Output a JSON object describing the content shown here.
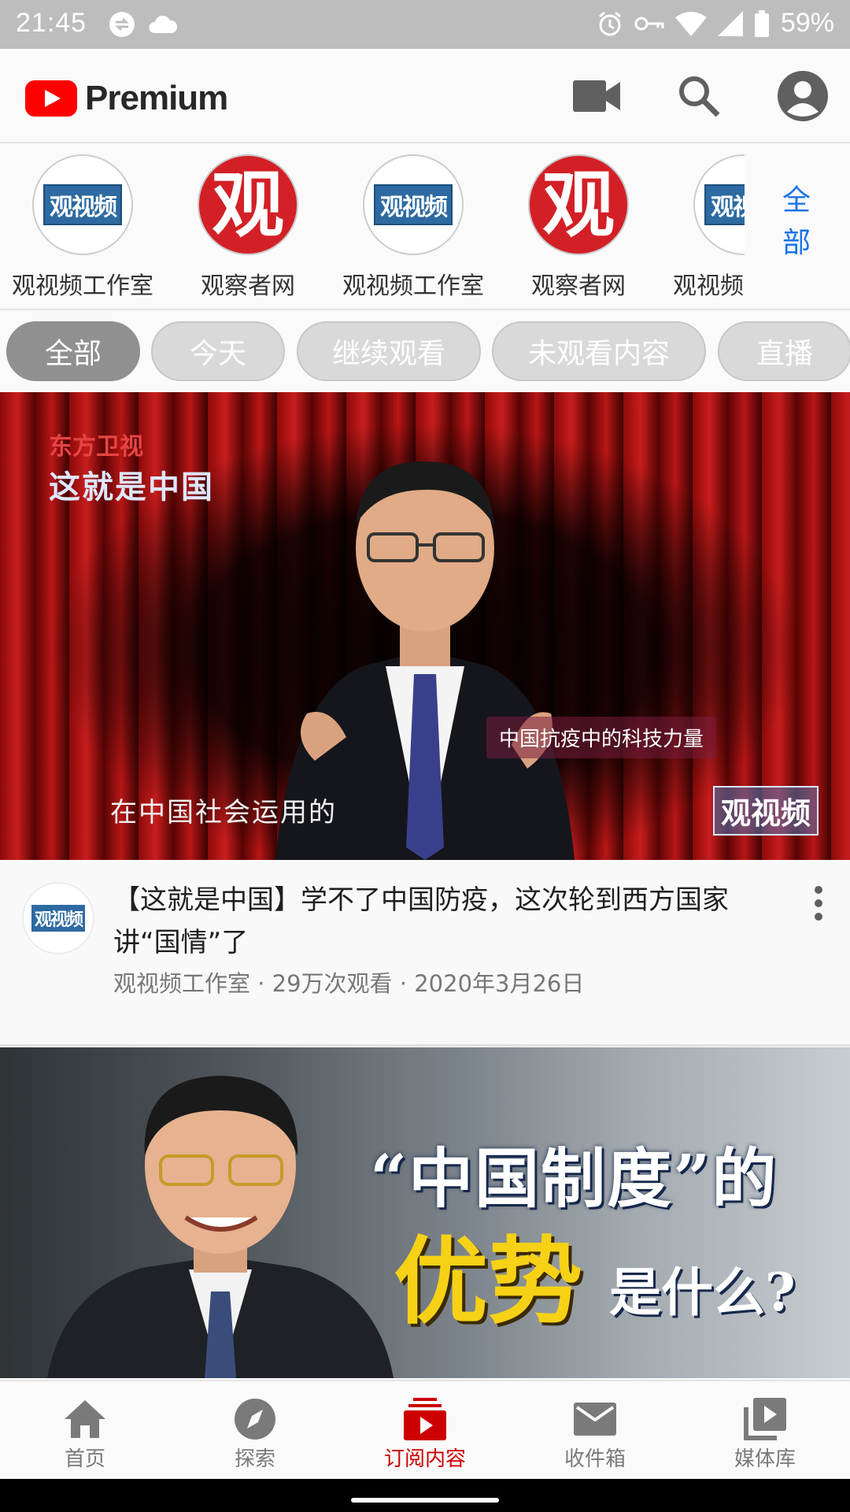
{
  "status_bar": {
    "time": "21:45",
    "battery": "59%"
  },
  "app_bar": {
    "logo_text": "Premium",
    "brand_color": "#ff0000"
  },
  "channels": {
    "items": [
      {
        "name": "观视频工作室",
        "avatar_text": "观视频",
        "style": "blue"
      },
      {
        "name": "观察者网",
        "avatar_text": "观",
        "style": "red"
      },
      {
        "name": "观视频工作室",
        "avatar_text": "观视频",
        "style": "blue"
      },
      {
        "name": "观察者网",
        "avatar_text": "观",
        "style": "red"
      },
      {
        "name": "观视频工作室",
        "avatar_text": "观视频",
        "style": "blue"
      }
    ],
    "all_label_line1": "全",
    "all_label_line2": "部"
  },
  "chips": [
    {
      "label": "全部",
      "active": true
    },
    {
      "label": "今天",
      "active": false
    },
    {
      "label": "继续观看",
      "active": false
    },
    {
      "label": "未观看内容",
      "active": false
    },
    {
      "label": "直播",
      "active": false
    }
  ],
  "videos": [
    {
      "thumbnail": {
        "logo_line1": "东方卫视",
        "logo_line2": "这就是中国",
        "lower_third": "中国抗疫中的科技力量",
        "subtitle": "在中国社会运用的",
        "watermark": "观视频"
      },
      "channel_avatar_text": "观视频",
      "title": "【这就是中国】学不了中国防疫，这次轮到西方国家讲“国情”了",
      "meta": "观视频工作室 · 29万次观看 · 2020年3月26日"
    },
    {
      "thumbnail": {
        "quote_text": "“中国制度”的",
        "highlight_text": "优势",
        "question_text": "是什么?"
      }
    }
  ],
  "bottom_nav": [
    {
      "label": "首页",
      "icon": "home-icon",
      "active": false
    },
    {
      "label": "探索",
      "icon": "compass-icon",
      "active": false
    },
    {
      "label": "订阅内容",
      "icon": "subscriptions-icon",
      "active": true
    },
    {
      "label": "收件箱",
      "icon": "mail-icon",
      "active": false
    },
    {
      "label": "媒体库",
      "icon": "library-icon",
      "active": false
    }
  ],
  "colors": {
    "active_nav": "#cc0000",
    "link_blue": "#1a73e8",
    "chip_active": "#909090",
    "chip_inactive": "#d9d9d9"
  }
}
